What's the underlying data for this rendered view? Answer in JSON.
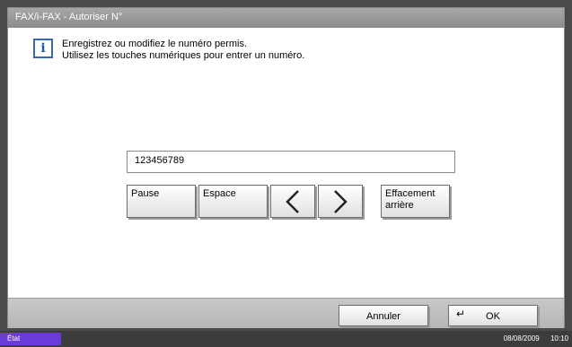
{
  "window": {
    "title": "FAX/i-FAX - Autoriser N°"
  },
  "message": {
    "line1": "Enregistrez ou modifiez le numéro permis.",
    "line2": "Utilisez les touches numériques pour entrer un numéro."
  },
  "number_field": {
    "value": "123456789"
  },
  "keys": {
    "pause": "Pause",
    "space": "Espace",
    "backspace_line1": "Effacement",
    "backspace_line2": "arrière"
  },
  "footer": {
    "cancel": "Annuler",
    "ok": "OK"
  },
  "status_bar": {
    "status": "État",
    "date": "08/08/2009",
    "time": "10:10"
  },
  "colors": {
    "accent": "#6a3bd8",
    "info": "#2354a8"
  }
}
